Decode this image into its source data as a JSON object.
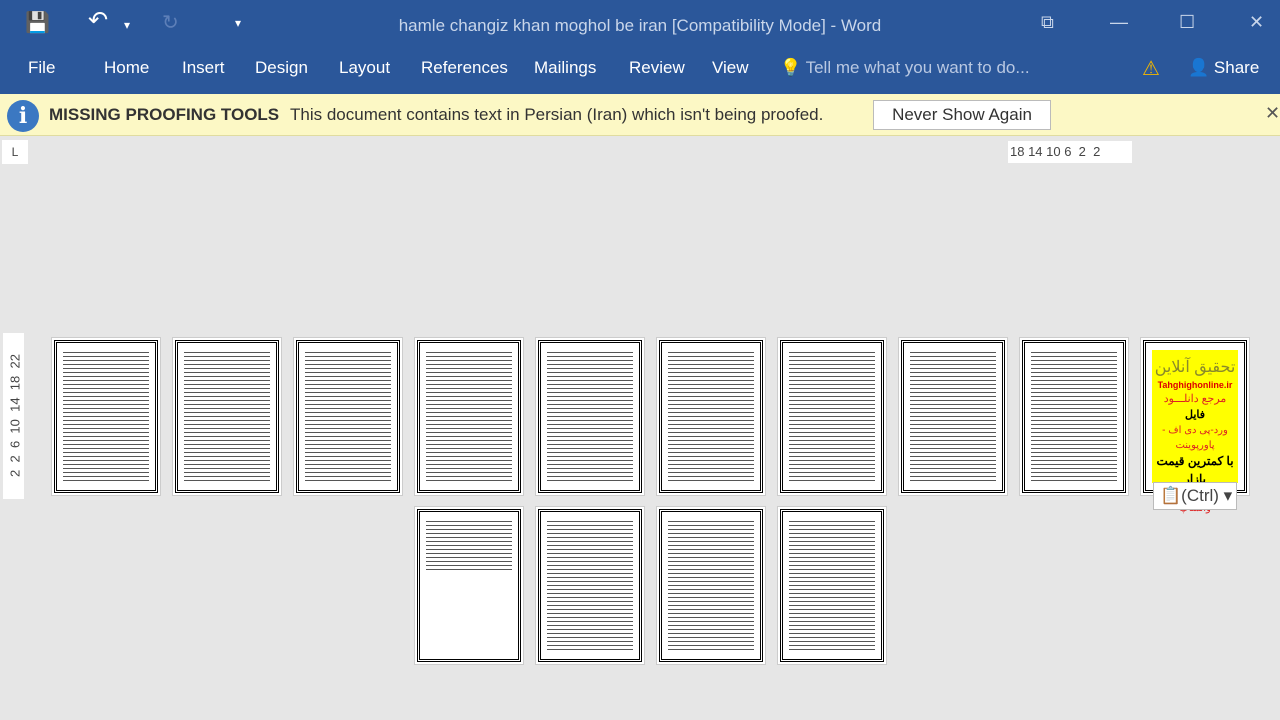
{
  "window": {
    "title": "hamle changiz khan moghol be iran [Compatibility Mode] - Word"
  },
  "qat": {
    "save": "💾",
    "undo": "↶",
    "undo_dropdown": "▾",
    "redo": "↻",
    "customize": "▾"
  },
  "window_controls": {
    "restore_ribbon": "⧉",
    "minimize": "—",
    "maximize": "☐",
    "close": "✕"
  },
  "ribbon": {
    "tabs": [
      "File",
      "Home",
      "Insert",
      "Design",
      "Layout",
      "References",
      "Mailings",
      "Review",
      "View"
    ],
    "tell_me": "Tell me what you want to do...",
    "share": "Share",
    "warning": "⚠"
  },
  "message_bar": {
    "title": "MISSING PROOFING TOOLS",
    "text": "This document contains text in Persian (Iran) which isn't being proofed.",
    "button": "Never Show Again",
    "close": "✕",
    "icon": "i"
  },
  "ruler": {
    "corner": "L",
    "horizontal": "18 14 10 6  2  2",
    "vertical": "2  2  6  10  14  18  22"
  },
  "ad_page": {
    "l1": "تحقیق آنلاین",
    "l2": "Tahghighonline.ir",
    "l3": "مرجع دانلـــود",
    "l4": "فایل",
    "l5": "ورد-پی دی اف - پاورپوینت",
    "l6": "با کمترین قیمت بازار",
    "l7": "09981366624 واتساپ"
  },
  "paste_options": {
    "label": "(Ctrl)",
    "icon": "clipboard-icon"
  },
  "colors": {
    "ribbon": "#2b579a",
    "message_bar": "#fcf8c5",
    "ad": "#ffff00"
  }
}
